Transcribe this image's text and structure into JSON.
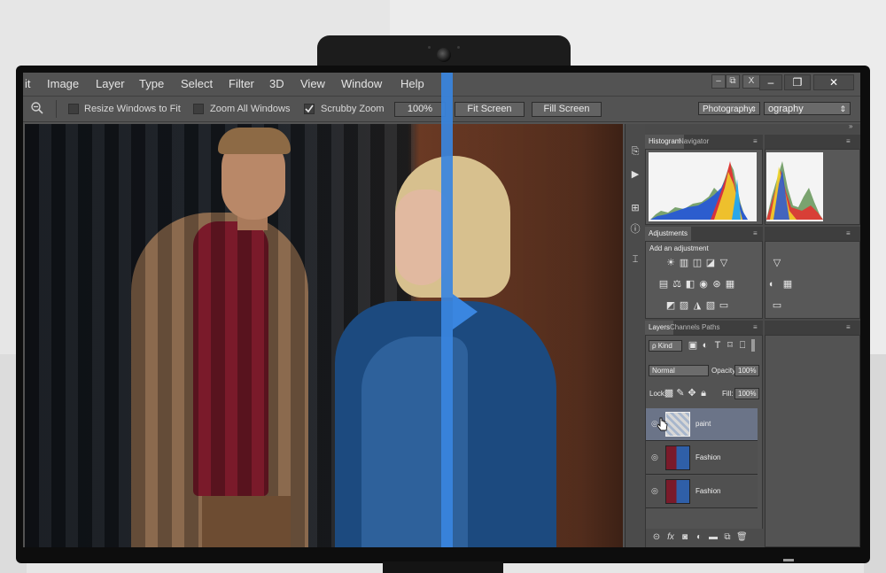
{
  "menubar": {
    "items": [
      "it",
      "Image",
      "Layer",
      "Type",
      "Select",
      "Filter",
      "3D",
      "View",
      "Window",
      "Help"
    ]
  },
  "window_controls": {
    "inner": [
      "–",
      "⧉",
      "X"
    ],
    "outer": [
      "–",
      "❐",
      "✕"
    ]
  },
  "options_bar": {
    "resize_windows": {
      "label": "Resize Windows to Fit",
      "checked": false
    },
    "zoom_all": {
      "label": "Zoom All Windows",
      "checked": false
    },
    "scrubby_zoom": {
      "label": "Scrubby Zoom",
      "checked": true
    },
    "zoom_value": "100%",
    "fit_screen": "Fit Screen",
    "fill_screen": "Fill Screen",
    "workspace_small": "Photography",
    "workspace_large": "ography"
  },
  "panels": {
    "histogram_tabs": [
      "Histogram",
      "Navigator"
    ],
    "adjustments_tab": "Adjustments",
    "adjustments_hint": "Add an adjustment",
    "layers_tabs": [
      "Layers",
      "Channels",
      "Paths"
    ],
    "kind_filter": "ρ Kind",
    "blend_mode": "Normal",
    "opacity_label": "Opacity:",
    "opacity_value": "100%",
    "lock_label": "Lock:",
    "fill_label": "Fill:",
    "fill_value": "100%",
    "layers": [
      {
        "name": "paint",
        "selected": true
      },
      {
        "name": "Fashion",
        "selected": false
      },
      {
        "name": "Fashion",
        "selected": false
      }
    ]
  },
  "colors": {
    "ui_gray": "#535353",
    "split_blue": "#3a86e0",
    "selected_layer": "#6b7488"
  }
}
